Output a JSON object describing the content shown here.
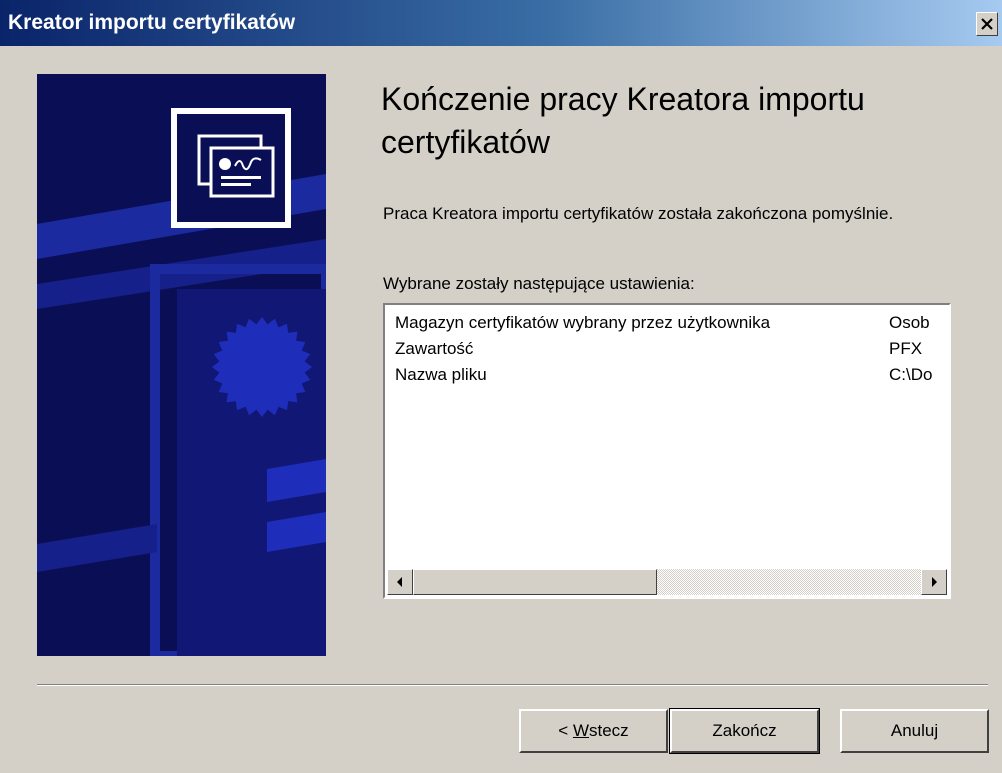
{
  "window": {
    "title": "Kreator importu certyfikatów"
  },
  "heading": "Kończenie pracy Kreatora importu certyfikatów",
  "intro_text": "Praca Kreatora importu certyfikatów została zakończona pomyślnie.",
  "settings_label": "Wybrane zostały następujące ustawienia:",
  "settings": [
    {
      "name": "Magazyn certyfikatów wybrany przez użytkownika",
      "value": "Osob"
    },
    {
      "name": "Zawartość",
      "value": "PFX"
    },
    {
      "name": "Nazwa pliku",
      "value": "C:\\Do"
    }
  ],
  "buttons": {
    "back_prefix": "< ",
    "back_mnemonic": "W",
    "back_rest": "stecz",
    "finish": "Zakończ",
    "cancel": "Anuluj"
  },
  "colors": {
    "dialog_bg": "#d4d0c8",
    "title_start": "#0a246a",
    "title_end": "#a6caf0",
    "banner_bg": "#0a0f55"
  },
  "icons": [
    "close-icon",
    "certificate-icon",
    "seal-icon",
    "scroll-left-icon",
    "scroll-right-icon"
  ]
}
